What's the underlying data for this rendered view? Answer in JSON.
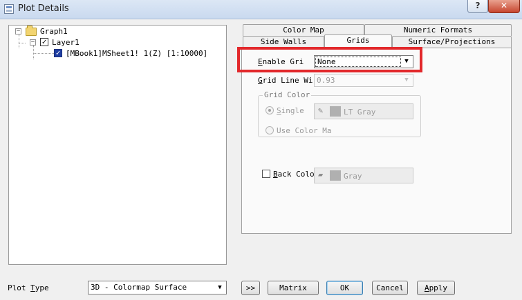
{
  "window": {
    "title": "Plot Details",
    "help_label": "?",
    "close_label": "✕"
  },
  "tree": {
    "nodes": [
      {
        "label": "Graph1",
        "expander": "−"
      },
      {
        "label": "Layer1",
        "expander": "−",
        "checked": "✓"
      },
      {
        "label": "[MBook1]MSheet1! 1(Z) [1:10000]",
        "checked": "✓"
      }
    ]
  },
  "tabs": {
    "row1": [
      "Color Map",
      "Numeric Formats"
    ],
    "row2": [
      "Side Walls",
      "Grids",
      "Surface/Projections"
    ],
    "active": "Grids"
  },
  "grids": {
    "enable_grid_label_key": "E",
    "enable_grid_label_rest": "nable Gri",
    "enable_grid_value": "None",
    "grid_line_width_label_key": "G",
    "grid_line_width_label_rest": "rid Line Wi",
    "grid_line_width_value": "0.93",
    "grid_color_group": "Grid Color",
    "single_label_key": "S",
    "single_label_rest": "ingle",
    "single_color": "LT Gray",
    "use_color_map_label": "Use Color Ma",
    "back_color_label_key": "B",
    "back_color_label_rest": "ack Colo",
    "back_color_value": "Gray"
  },
  "footer": {
    "plot_type_label_rest": "Plot ",
    "plot_type_label_key": "T",
    "plot_type_label_tail": "ype",
    "plot_type_value": "3D - Colormap Surface",
    "expand_button": ">>",
    "matrix_button": "Matrix",
    "ok_button": "OK",
    "cancel_button": "Cancel",
    "apply_key": "A",
    "apply_rest": "pply"
  },
  "colors": {
    "highlight": "#e2282b",
    "checkbox_selected": "#1f3ea2"
  },
  "icons": {
    "dropdown": "▼",
    "pencil": "✎",
    "paint_bucket": "▰"
  }
}
